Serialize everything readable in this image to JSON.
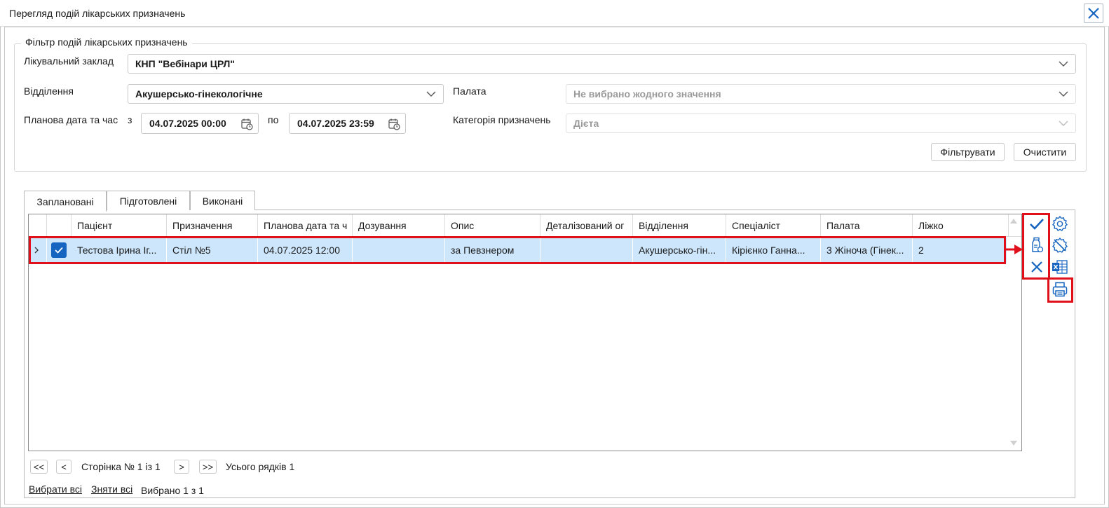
{
  "window": {
    "title": "Перегляд подій лікарських призначень"
  },
  "filter": {
    "legend": "Фільтр подій лікарських призначень",
    "facility_label": "Лікувальний заклад",
    "facility_value": "КНП \"Вебінари ЦРЛ\"",
    "department_label": "Відділення",
    "department_value": "Акушерсько-гінекологічне",
    "ward_label": "Палата",
    "ward_value": "Не вибрано жодного значення",
    "date_label": "Планова дата та час",
    "from_label": "з",
    "from_value": "04.07.2025 00:00",
    "to_label": "по",
    "to_value": "04.07.2025 23:59",
    "category_label": "Категорія призначень",
    "category_value": "Дієта",
    "filter_button": "Фільтрувати",
    "clear_button": "Очистити"
  },
  "tabs": [
    "Заплановані",
    "Підготовлені",
    "Виконані"
  ],
  "grid": {
    "columns": [
      "Пацієнт",
      "Призначення",
      "Планова дата та ч",
      "Дозування",
      "Опис",
      "Деталізований ог",
      "Відділення",
      "Спеціаліст",
      "Палата",
      "Ліжко"
    ],
    "rows": [
      {
        "checked": true,
        "cells": [
          "Тестова Ірина Іг...",
          "Стіл №5",
          "04.07.2025 12:00",
          "",
          "за Певзнером",
          "",
          "Акушерсько-гін...",
          "Кірієнко Ганна...",
          "3 Жіноча (Гінек...",
          "2"
        ]
      }
    ]
  },
  "pager": {
    "first": "<<",
    "prev": "<",
    "page_text": "Сторінка № 1 із 1",
    "next": ">",
    "last": ">>",
    "total_text": "Усього рядків 1"
  },
  "selection": {
    "select_all": "Вибрати всі",
    "deselect_all": "Зняти всі",
    "selected_text": "Вибрано 1 з 1"
  },
  "side_actions": [
    "check-icon",
    "medicine-bottle-icon",
    "cross-icon",
    "gear-icon",
    "gear-remove-icon",
    "excel-icon",
    "printer-icon"
  ],
  "colors": {
    "accent": "#1565c0",
    "highlight": "#e0101b",
    "row_selected": "#cde6fb"
  }
}
